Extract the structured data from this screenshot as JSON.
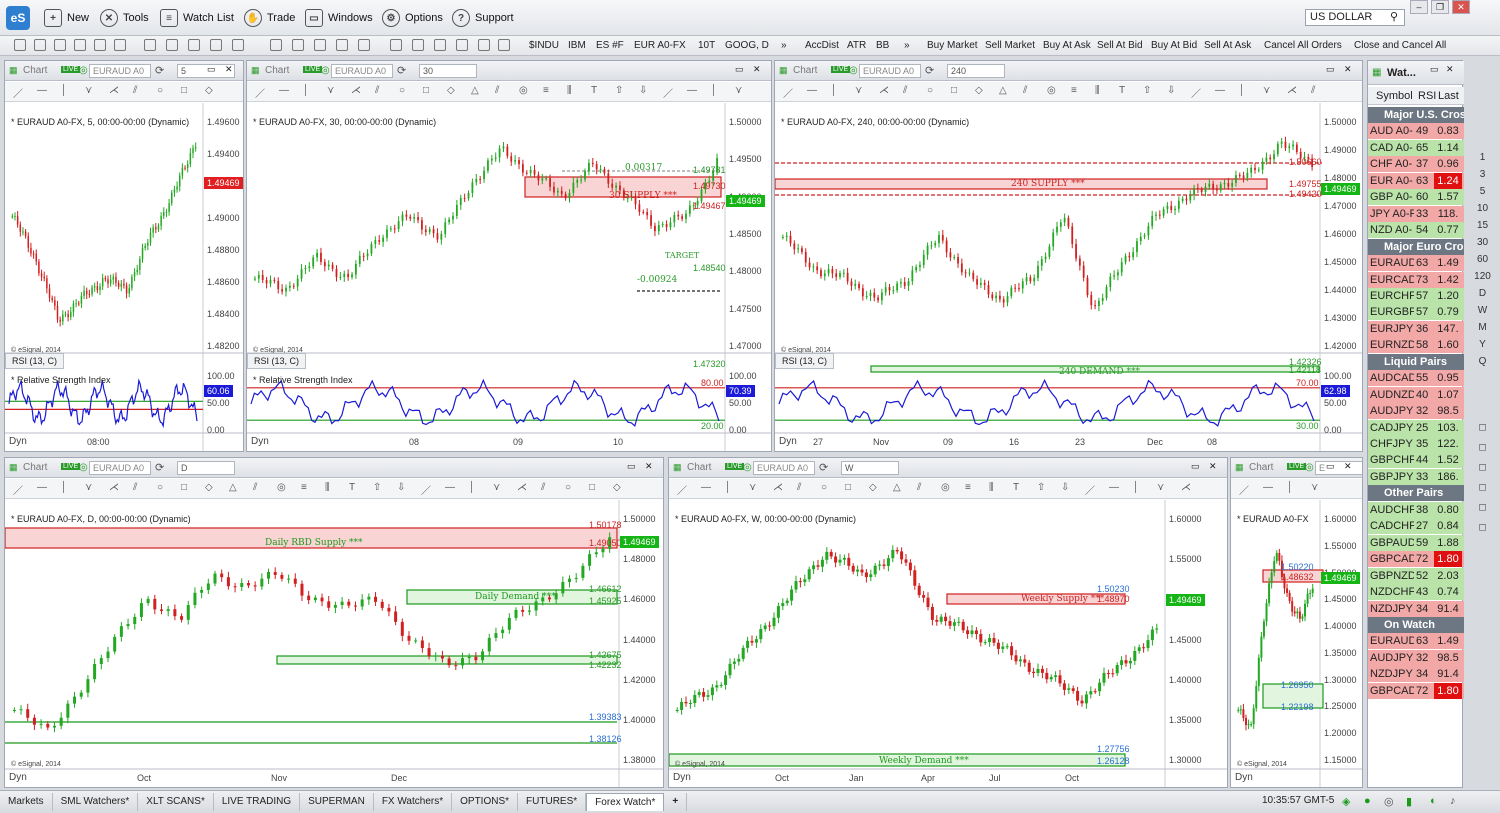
{
  "app": {
    "logo": "eS",
    "search_value": "US DOLLAR"
  },
  "menu": [
    {
      "label": "New",
      "icon": "new-chart-icon"
    },
    {
      "label": "Tools",
      "icon": "tools-icon"
    },
    {
      "label": "Watch List",
      "icon": "watchlist-icon"
    },
    {
      "label": "Trade",
      "icon": "trade-icon"
    },
    {
      "label": "Windows",
      "icon": "windows-icon"
    },
    {
      "label": "Options",
      "icon": "gear-icon"
    },
    {
      "label": "Support",
      "icon": "help-icon"
    }
  ],
  "toolbar": {
    "symbols": [
      "$INDU",
      "IBM",
      "ES #F",
      "EUR A0-FX",
      "10T",
      "GOOG, D",
      "AccDist",
      "ATR",
      "BB"
    ],
    "more": "»",
    "trade_buttons": [
      "Buy Market",
      "Sell Market",
      "Buy At Ask",
      "Sell At Bid",
      "Buy At Bid",
      "Sell At Ask",
      "Cancel All Orders",
      "Close and Cancel All"
    ]
  },
  "charts": {
    "c5": {
      "title": "Chart",
      "symbol": "EURAUD A0",
      "interval": "5",
      "header": "* EURAUD A0-FX, 5, 00:00-00:00 (Dynamic)",
      "price_tag": "1.49469",
      "yaxis": [
        "1.49600",
        "1.49400",
        "1.49200",
        "1.49000",
        "1.48800",
        "1.48600",
        "1.48400",
        "1.48200"
      ],
      "xaxis": [
        "08:00"
      ],
      "copyright": "© eSignal, 2014",
      "rsi_tab": "RSI (13, C)",
      "rsi_label": "* Relative Strength Index",
      "rsi_axis": [
        "100.00",
        "50.00",
        "0.00"
      ],
      "rsi_tag": "60.06"
    },
    "c30": {
      "title": "Chart",
      "symbol": "EURAUD A0",
      "interval": "30",
      "header": "* EURAUD A0-FX, 30, 00:00-00:00 (Dynamic)",
      "price_tag": "1.49469",
      "yaxis": [
        "1.50000",
        "1.49500",
        "1.49000",
        "1.48500",
        "1.48000",
        "1.47500",
        "1.47000"
      ],
      "xaxis": [
        "08",
        "09",
        "10"
      ],
      "levels": [
        "1.49781",
        "1.49730",
        "1.49467",
        "1.48540",
        "1.47320"
      ],
      "zone_label": "30 SUPPLY ***",
      "target": "TARGET",
      "fib_top": "0.00317",
      "fib_bottom": "-0.00924",
      "copyright": "© eSignal, 2014",
      "rsi_tab": "RSI (13, C)",
      "rsi_label": "* Relative Strength Index",
      "rsi_axis": [
        "100.00",
        "50.00",
        "0.00"
      ],
      "rsi_levels": [
        "80.00",
        "20.00"
      ],
      "rsi_tag": "70.39"
    },
    "c240": {
      "title": "Chart",
      "symbol": "EURAUD A0",
      "interval": "240",
      "header": "* EURAUD A0-FX, 240, 00:00-00:00 (Dynamic)",
      "price_tag": "1.49469",
      "yaxis": [
        "1.50000",
        "1.49000",
        "1.48000",
        "1.47000",
        "1.46000",
        "1.45000",
        "1.44000",
        "1.43000",
        "1.42000"
      ],
      "xaxis": [
        "27",
        "Nov",
        "09",
        "16",
        "23",
        "Dec",
        "08"
      ],
      "levels": [
        "1.50660",
        "1.49755",
        "1.49420",
        "1.42326",
        "1.42118"
      ],
      "supply_label": "240 SUPPLY ***",
      "demand_label": "240 DEMAND ***",
      "copyright": "© eSignal, 2014",
      "rsi_tab": "RSI (13, C)",
      "rsi_axis": [
        "100.00",
        "50.00",
        "0.00"
      ],
      "rsi_levels": [
        "70.00",
        "30.00"
      ],
      "rsi_tag": "62.98"
    },
    "cD": {
      "title": "Chart",
      "symbol": "EURAUD A0",
      "interval": "D",
      "header": "* EURAUD A0-FX, D, 00:00-00:00 (Dynamic)",
      "price_tag": "1.49469",
      "yaxis": [
        "1.50000",
        "1.48000",
        "1.46000",
        "1.44000",
        "1.42000",
        "1.40000",
        "1.38000"
      ],
      "xaxis": [
        "Oct",
        "Nov",
        "Dec"
      ],
      "levels": [
        "1.50178",
        "1.49050",
        "1.46612",
        "1.45925",
        "1.42675",
        "1.42232",
        "1.39383",
        "1.38126"
      ],
      "supply_label": "Daily RBD Supply ***",
      "demand_label": "Daily Demand ***",
      "copyright": "© eSignal, 2014"
    },
    "cW": {
      "title": "Chart",
      "symbol": "EURAUD A0",
      "interval": "W",
      "header": "* EURAUD A0-FX, W, 00:00-00:00 (Dynamic)",
      "price_tag": "1.49469",
      "yaxis": [
        "1.60000",
        "1.55000",
        "1.50000",
        "1.45000",
        "1.40000",
        "1.35000",
        "1.30000"
      ],
      "xaxis": [
        "Oct",
        "Jan",
        "Apr",
        "Jul",
        "Oct"
      ],
      "levels": [
        "1.50230",
        "1.48970",
        "1.27756",
        "1.26128"
      ],
      "supply_label": "Weekly Supply ***",
      "demand_label": "Weekly Demand ***",
      "copyright": "© eSignal, 2014"
    },
    "cM": {
      "title": "Chart",
      "symbol": "E",
      "header": "* EURAUD A0-FX",
      "price_tag": "1.49469",
      "yaxis": [
        "1.60000",
        "1.55000",
        "1.50000",
        "1.45000",
        "1.40000",
        "1.35000",
        "1.30000",
        "1.25000",
        "1.20000",
        "1.15000"
      ],
      "levels": [
        "1.50220",
        "1.48632",
        "1.26950",
        "1.22198"
      ],
      "copyright": "© eSignal, 2014"
    }
  },
  "dyn": "Dyn",
  "watch": {
    "title": "Wat...",
    "cols": [
      "Symbol",
      "RSI",
      "Last"
    ],
    "rows": [
      {
        "section": "Major U.S. Cros"
      },
      {
        "sym": "AUD A0-",
        "rsi": "49",
        "last": "0.83",
        "c": "#f3a8a8"
      },
      {
        "sym": "CAD A0-",
        "rsi": "65",
        "last": "1.14",
        "c": "#b9e3a8"
      },
      {
        "sym": "CHF A0-",
        "rsi": "37",
        "last": "0.96",
        "c": "#f3a8a8"
      },
      {
        "sym": "EUR A0-",
        "rsi": "63",
        "last": "1.24",
        "c": "#f3a8a8",
        "hot": true
      },
      {
        "sym": "GBP A0-",
        "rsi": "60",
        "last": "1.57",
        "c": "#b9e3a8"
      },
      {
        "sym": "JPY A0-F",
        "rsi": "33",
        "last": "118.",
        "c": "#f3a8a8"
      },
      {
        "sym": "NZD A0-",
        "rsi": "54",
        "last": "0.77",
        "c": "#b9e3a8"
      },
      {
        "section": "Major Euro Cros"
      },
      {
        "sym": "EURAUD",
        "rsi": "63",
        "last": "1.49",
        "c": "#f3a8a8"
      },
      {
        "sym": "EURCAD",
        "rsi": "73",
        "last": "1.42",
        "c": "#f3a8a8"
      },
      {
        "sym": "EURCHF",
        "rsi": "57",
        "last": "1.20",
        "c": "#b9e3a8"
      },
      {
        "sym": "EURGBP",
        "rsi": "57",
        "last": "0.79",
        "c": "#b9e3a8"
      },
      {
        "sym": "EURJPY",
        "rsi": "36",
        "last": "147.",
        "c": "#f3a8a8"
      },
      {
        "sym": "EURNZD",
        "rsi": "58",
        "last": "1.60",
        "c": "#f3a8a8"
      },
      {
        "section": "Liquid Pairs"
      },
      {
        "sym": "AUDCAD",
        "rsi": "55",
        "last": "0.95",
        "c": "#f3a8a8"
      },
      {
        "sym": "AUDNZD",
        "rsi": "40",
        "last": "1.07",
        "c": "#f3a8a8"
      },
      {
        "sym": "AUDJPY",
        "rsi": "32",
        "last": "98.5",
        "c": "#f3a8a8"
      },
      {
        "sym": "CADJPY",
        "rsi": "25",
        "last": "103.",
        "c": "#b9e3a8"
      },
      {
        "sym": "CHFJPY",
        "rsi": "35",
        "last": "122.",
        "c": "#b9e3a8"
      },
      {
        "sym": "GBPCHF",
        "rsi": "44",
        "last": "1.52",
        "c": "#b9e3a8"
      },
      {
        "sym": "GBPJPY",
        "rsi": "33",
        "last": "186.",
        "c": "#b9e3a8"
      },
      {
        "section": "Other Pairs"
      },
      {
        "sym": "AUDCHF",
        "rsi": "38",
        "last": "0.80",
        "c": "#b9e3a8"
      },
      {
        "sym": "CADCHF",
        "rsi": "27",
        "last": "0.84",
        "c": "#b9e3a8"
      },
      {
        "sym": "GBPAUD",
        "rsi": "59",
        "last": "1.88",
        "c": "#b9e3a8"
      },
      {
        "sym": "GBPCAD",
        "rsi": "72",
        "last": "1.80",
        "c": "#f3a8a8",
        "hot": true
      },
      {
        "sym": "GBPNZD",
        "rsi": "52",
        "last": "2.03",
        "c": "#b9e3a8"
      },
      {
        "sym": "NZDCHF",
        "rsi": "43",
        "last": "0.74",
        "c": "#b9e3a8"
      },
      {
        "sym": "NZDJPY",
        "rsi": "34",
        "last": "91.4",
        "c": "#f3a8a8"
      },
      {
        "section": "On Watch"
      },
      {
        "sym": "EURAUD",
        "rsi": "63",
        "last": "1.49",
        "c": "#f3a8a8"
      },
      {
        "sym": "AUDJPY",
        "rsi": "32",
        "last": "98.5",
        "c": "#f3a8a8"
      },
      {
        "sym": "NZDJPY",
        "rsi": "34",
        "last": "91.4",
        "c": "#f3a8a8"
      },
      {
        "sym": "GBPCAD",
        "rsi": "72",
        "last": "1.80",
        "c": "#f3a8a8",
        "hot": true
      }
    ]
  },
  "right_intervals": [
    "1",
    "3",
    "5",
    "10",
    "15",
    "30",
    "60",
    "120",
    "D",
    "W",
    "M",
    "Y",
    "Q"
  ],
  "tabs": [
    "Markets",
    "SML Watchers*",
    "XLT SCANS*",
    "LIVE TRADING",
    "SUPERMAN",
    "FX Watchers*",
    "OPTIONS*",
    "FUTURES*",
    "Forex Watch*"
  ],
  "active_tab": "Forex Watch*",
  "add_tab": "+",
  "clock": "10:35:57 GMT-5",
  "colors": {
    "supply": "#f9d4d4",
    "demand": "#e2f5df",
    "price_tag_red": "#e02020",
    "price_tag_green": "#15b515",
    "rsi_line": "#1a1ad8",
    "candle_up": "#22a822",
    "candle_down": "#d02020"
  }
}
